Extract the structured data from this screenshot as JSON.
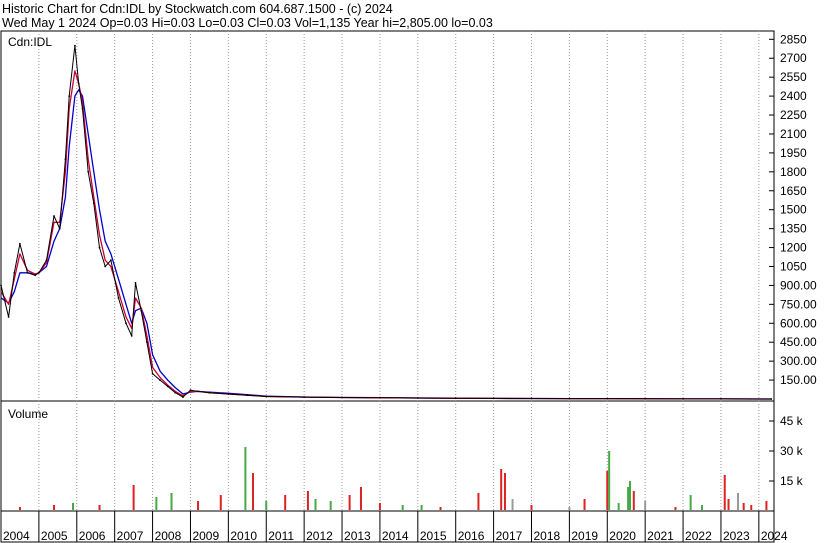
{
  "header": {
    "line1": "Historic Chart for Cdn:IDL by Stockwatch.com 604.687.1500 - (c) 2024",
    "line2": "Wed May  1 2024  Op=0.03  Hi=0.03  Lo=0.03  Cl=0.03  Vol=1,135  Year hi=2,805.00  lo=0.03"
  },
  "colors": {
    "price": "#000000",
    "ma_short": "#cc0033",
    "ma_long": "#0000cc",
    "vol_up": "#44aa44",
    "vol_down": "#dd2222",
    "vol_flat": "#999999",
    "grid": "#999999",
    "background": "#ffffff"
  },
  "chart_data": [
    {
      "type": "line",
      "panel": "price",
      "symbol_label": "Cdn:IDL",
      "ylim": [
        0,
        2900
      ],
      "y_ticks": [
        150,
        300,
        450,
        600,
        750,
        900,
        1050,
        1200,
        1350,
        1500,
        1650,
        1800,
        1950,
        2100,
        2250,
        2400,
        2550,
        2700,
        2850
      ],
      "y_tick_labels": [
        "150.00",
        "300.00",
        "450.00",
        "600.00",
        "750.00",
        "900.00",
        "1050",
        "1200",
        "1350",
        "1500",
        "1650",
        "1800",
        "1950",
        "2100",
        "2250",
        "2400",
        "2550",
        "2700",
        "2850"
      ],
      "x": [
        2004.0,
        2004.2,
        2004.35,
        2004.5,
        2004.7,
        2004.9,
        2005.0,
        2005.2,
        2005.4,
        2005.55,
        2005.7,
        2005.8,
        2005.95,
        2006.05,
        2006.15,
        2006.3,
        2006.45,
        2006.6,
        2006.75,
        2006.9,
        2007.1,
        2007.3,
        2007.45,
        2007.55,
        2007.7,
        2007.85,
        2008.0,
        2008.2,
        2008.4,
        2008.6,
        2008.8,
        2009.0,
        2009.2,
        2009.5,
        2010.0,
        2010.5,
        2011.0,
        2012.0,
        2013.0,
        2014.0,
        2015.0,
        2016.0,
        2017.0,
        2018.0,
        2019.0,
        2020.0,
        2021.0,
        2022.0,
        2023.0,
        2024.33
      ],
      "series": [
        {
          "name": "Price",
          "values": [
            900,
            650,
            1000,
            1230,
            1000,
            980,
            1000,
            1100,
            1450,
            1350,
            1900,
            2400,
            2800,
            2500,
            2300,
            1800,
            1550,
            1200,
            1050,
            1100,
            800,
            600,
            500,
            920,
            700,
            450,
            200,
            150,
            100,
            50,
            15,
            70,
            60,
            50,
            40,
            30,
            20,
            15,
            12,
            10,
            8,
            6,
            5,
            4,
            3,
            3,
            2,
            1,
            0.5,
            0.03
          ]
        }
      ],
      "moving_averages": [
        {
          "values": [
            850,
            750,
            950,
            1150,
            1020,
            990,
            1000,
            1080,
            1400,
            1400,
            1800,
            2300,
            2600,
            2500,
            2350,
            1900,
            1600,
            1300,
            1100,
            1050,
            850,
            650,
            560,
            800,
            720,
            500,
            250,
            170,
            110,
            60,
            25,
            60,
            60,
            50,
            40,
            30,
            20,
            15,
            12,
            10,
            8,
            6,
            5,
            4,
            3,
            3,
            2,
            1,
            0.5,
            0.1
          ]
        },
        {
          "values": [
            800,
            760,
            850,
            1000,
            1000,
            990,
            1000,
            1050,
            1250,
            1350,
            1600,
            2000,
            2400,
            2450,
            2400,
            2100,
            1800,
            1500,
            1250,
            1150,
            950,
            750,
            600,
            700,
            720,
            600,
            350,
            220,
            150,
            90,
            40,
            55,
            60,
            55,
            45,
            35,
            22,
            16,
            12,
            10,
            8,
            6,
            5,
            4,
            3,
            3,
            2,
            1,
            0.5,
            0.2
          ]
        }
      ]
    },
    {
      "type": "bar",
      "panel": "volume",
      "title": "Volume",
      "ylim": [
        0,
        55000
      ],
      "y_ticks": [
        15000,
        30000,
        45000
      ],
      "y_tick_labels": [
        "15 k",
        "30 k",
        "45 k"
      ],
      "x": [
        2004.5,
        2005.4,
        2005.9,
        2006.6,
        2007.5,
        2008.1,
        2008.5,
        2009.2,
        2009.8,
        2010.45,
        2010.65,
        2011.0,
        2011.5,
        2012.1,
        2012.3,
        2012.7,
        2013.2,
        2013.5,
        2014.0,
        2014.6,
        2015.1,
        2015.6,
        2016.6,
        2017.2,
        2017.3,
        2017.5,
        2018.0,
        2019.0,
        2019.4,
        2020.0,
        2020.05,
        2020.3,
        2020.55,
        2020.6,
        2020.7,
        2021.0,
        2021.8,
        2022.2,
        2022.5,
        2023.1,
        2023.2,
        2023.45,
        2023.6,
        2023.8,
        2024.2
      ],
      "values": [
        2000,
        3000,
        4000,
        3000,
        13000,
        7000,
        9000,
        5000,
        8000,
        32000,
        19000,
        5000,
        8000,
        10000,
        6000,
        5000,
        8000,
        12000,
        4000,
        3000,
        3000,
        2000,
        9000,
        21000,
        19000,
        6000,
        3000,
        2000,
        6000,
        20000,
        30000,
        4000,
        12000,
        15000,
        10000,
        5000,
        2000,
        8000,
        3000,
        18000,
        6000,
        9000,
        4000,
        3000,
        5000
      ],
      "bar_colors": [
        "down",
        "down",
        "up",
        "down",
        "down",
        "up",
        "up",
        "down",
        "down",
        "up",
        "down",
        "up",
        "down",
        "down",
        "up",
        "up",
        "down",
        "down",
        "down",
        "up",
        "up",
        "down",
        "down",
        "down",
        "down",
        "flat",
        "down",
        "flat",
        "down",
        "down",
        "up",
        "up",
        "up",
        "up",
        "down",
        "flat",
        "down",
        "up",
        "up",
        "down",
        "down",
        "flat",
        "down",
        "down",
        "down"
      ]
    }
  ],
  "x_axis": {
    "xlim": [
      2004.0,
      2024.4
    ],
    "labels": [
      "2004",
      "2005",
      "2006",
      "2007",
      "2008",
      "2009",
      "2010",
      "2011",
      "2012",
      "2013",
      "2014",
      "2015",
      "2016",
      "2017",
      "2018",
      "2019",
      "2020",
      "2021",
      "2022",
      "2023",
      "2024"
    ]
  }
}
